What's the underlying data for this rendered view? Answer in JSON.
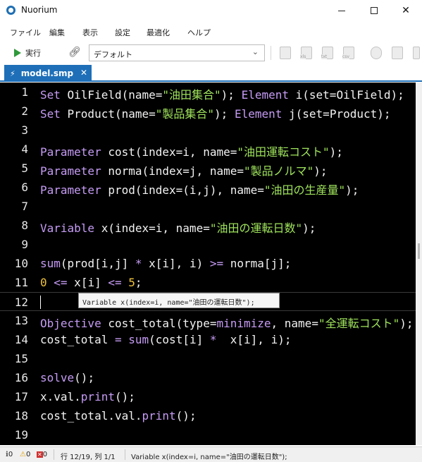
{
  "window": {
    "title": "Nuorium"
  },
  "menu": [
    "ファイル",
    "編集",
    "表示",
    "設定",
    "最適化",
    "ヘルプ"
  ],
  "toolbar": {
    "run_label": "実行",
    "config_value": "デフォルト",
    "disabled_icons": [
      {
        "name": "new-file-icon",
        "text": ""
      },
      {
        "name": "export-xls-icon",
        "text": "xls"
      },
      {
        "name": "export-txt-icon",
        "text": "txt"
      },
      {
        "name": "export-csv-icon",
        "text": "csv"
      },
      {
        "name": "install-icon",
        "text": ""
      },
      {
        "name": "print-icon",
        "text": ""
      }
    ]
  },
  "tab": {
    "label": "model.smp",
    "close": "✕"
  },
  "editor": {
    "current_line": 12,
    "lines": [
      [
        [
          "kw",
          "Set "
        ],
        [
          "",
          "OilField(name="
        ],
        [
          "str",
          "\"油田集合\""
        ],
        [
          "",
          "); "
        ],
        [
          "kw",
          "Element "
        ],
        [
          "",
          "i(set=OilField);"
        ]
      ],
      [
        [
          "kw",
          "Set "
        ],
        [
          "",
          "Product(name="
        ],
        [
          "str",
          "\"製品集合\""
        ],
        [
          "",
          "); "
        ],
        [
          "kw",
          "Element "
        ],
        [
          "",
          "j(set=Product);"
        ]
      ],
      [],
      [
        [
          "kw",
          "Parameter "
        ],
        [
          "",
          "cost(index=i, name="
        ],
        [
          "str",
          "\"油田運転コスト\""
        ],
        [
          "",
          ");"
        ]
      ],
      [
        [
          "kw",
          "Parameter "
        ],
        [
          "",
          "norma(index=j, name="
        ],
        [
          "str",
          "\"製品ノルマ\""
        ],
        [
          "",
          ");"
        ]
      ],
      [
        [
          "kw",
          "Parameter "
        ],
        [
          "",
          "prod(index=(i,j), name="
        ],
        [
          "str",
          "\"油田の生産量\""
        ],
        [
          "",
          ");"
        ]
      ],
      [],
      [
        [
          "kw",
          "Variable "
        ],
        [
          "",
          "x(index=i, name="
        ],
        [
          "str",
          "\"油田の運転日数\""
        ],
        [
          "",
          ");"
        ]
      ],
      [],
      [
        [
          "kw",
          "sum"
        ],
        [
          "",
          "(prod[i,j] "
        ],
        [
          "op",
          "*"
        ],
        [
          "",
          " x[i], i) "
        ],
        [
          "op",
          ">="
        ],
        [
          "",
          ""
        ],
        [
          "op",
          ""
        ],
        [
          "",
          " norma[j];"
        ]
      ],
      [
        [
          "num",
          "0"
        ],
        [
          "",
          " "
        ],
        [
          "op",
          "<="
        ],
        [
          "",
          " x[i] "
        ],
        [
          "op",
          "<="
        ],
        [
          "",
          " "
        ],
        [
          "num",
          "5"
        ],
        [
          "",
          ";"
        ]
      ],
      [],
      [
        [
          "kw",
          "Objective "
        ],
        [
          "",
          "cost_total(type="
        ],
        [
          "kw",
          "minimize"
        ],
        [
          "",
          ", name="
        ],
        [
          "str",
          "\"全運転コスト\""
        ],
        [
          "",
          ");"
        ]
      ],
      [
        [
          "",
          "cost_total "
        ],
        [
          "op",
          "="
        ],
        [
          "",
          " "
        ],
        [
          "kw",
          "sum"
        ],
        [
          "",
          "(cost[i] "
        ],
        [
          "op",
          "*"
        ],
        [
          "",
          "",
          " "
        ],
        [
          "",
          " x[i], i);"
        ]
      ],
      [],
      [
        [
          "kw",
          "solve"
        ],
        [
          "",
          "();"
        ]
      ],
      [
        [
          "",
          "x.val."
        ],
        [
          "kw",
          "print"
        ],
        [
          "",
          "();"
        ]
      ],
      [
        [
          "",
          "cost_total.val."
        ],
        [
          "kw",
          "print"
        ],
        [
          "",
          "();"
        ]
      ],
      []
    ],
    "tooltip": "Variable x(index=i, name=\"油田の運転日数\");"
  },
  "status": {
    "info_count": "0",
    "warning_count": "0",
    "error_count": "0",
    "position": "行 12/19, 列 1/1",
    "message": "Variable x(index=i, name=\"油田の運転日数\");"
  }
}
